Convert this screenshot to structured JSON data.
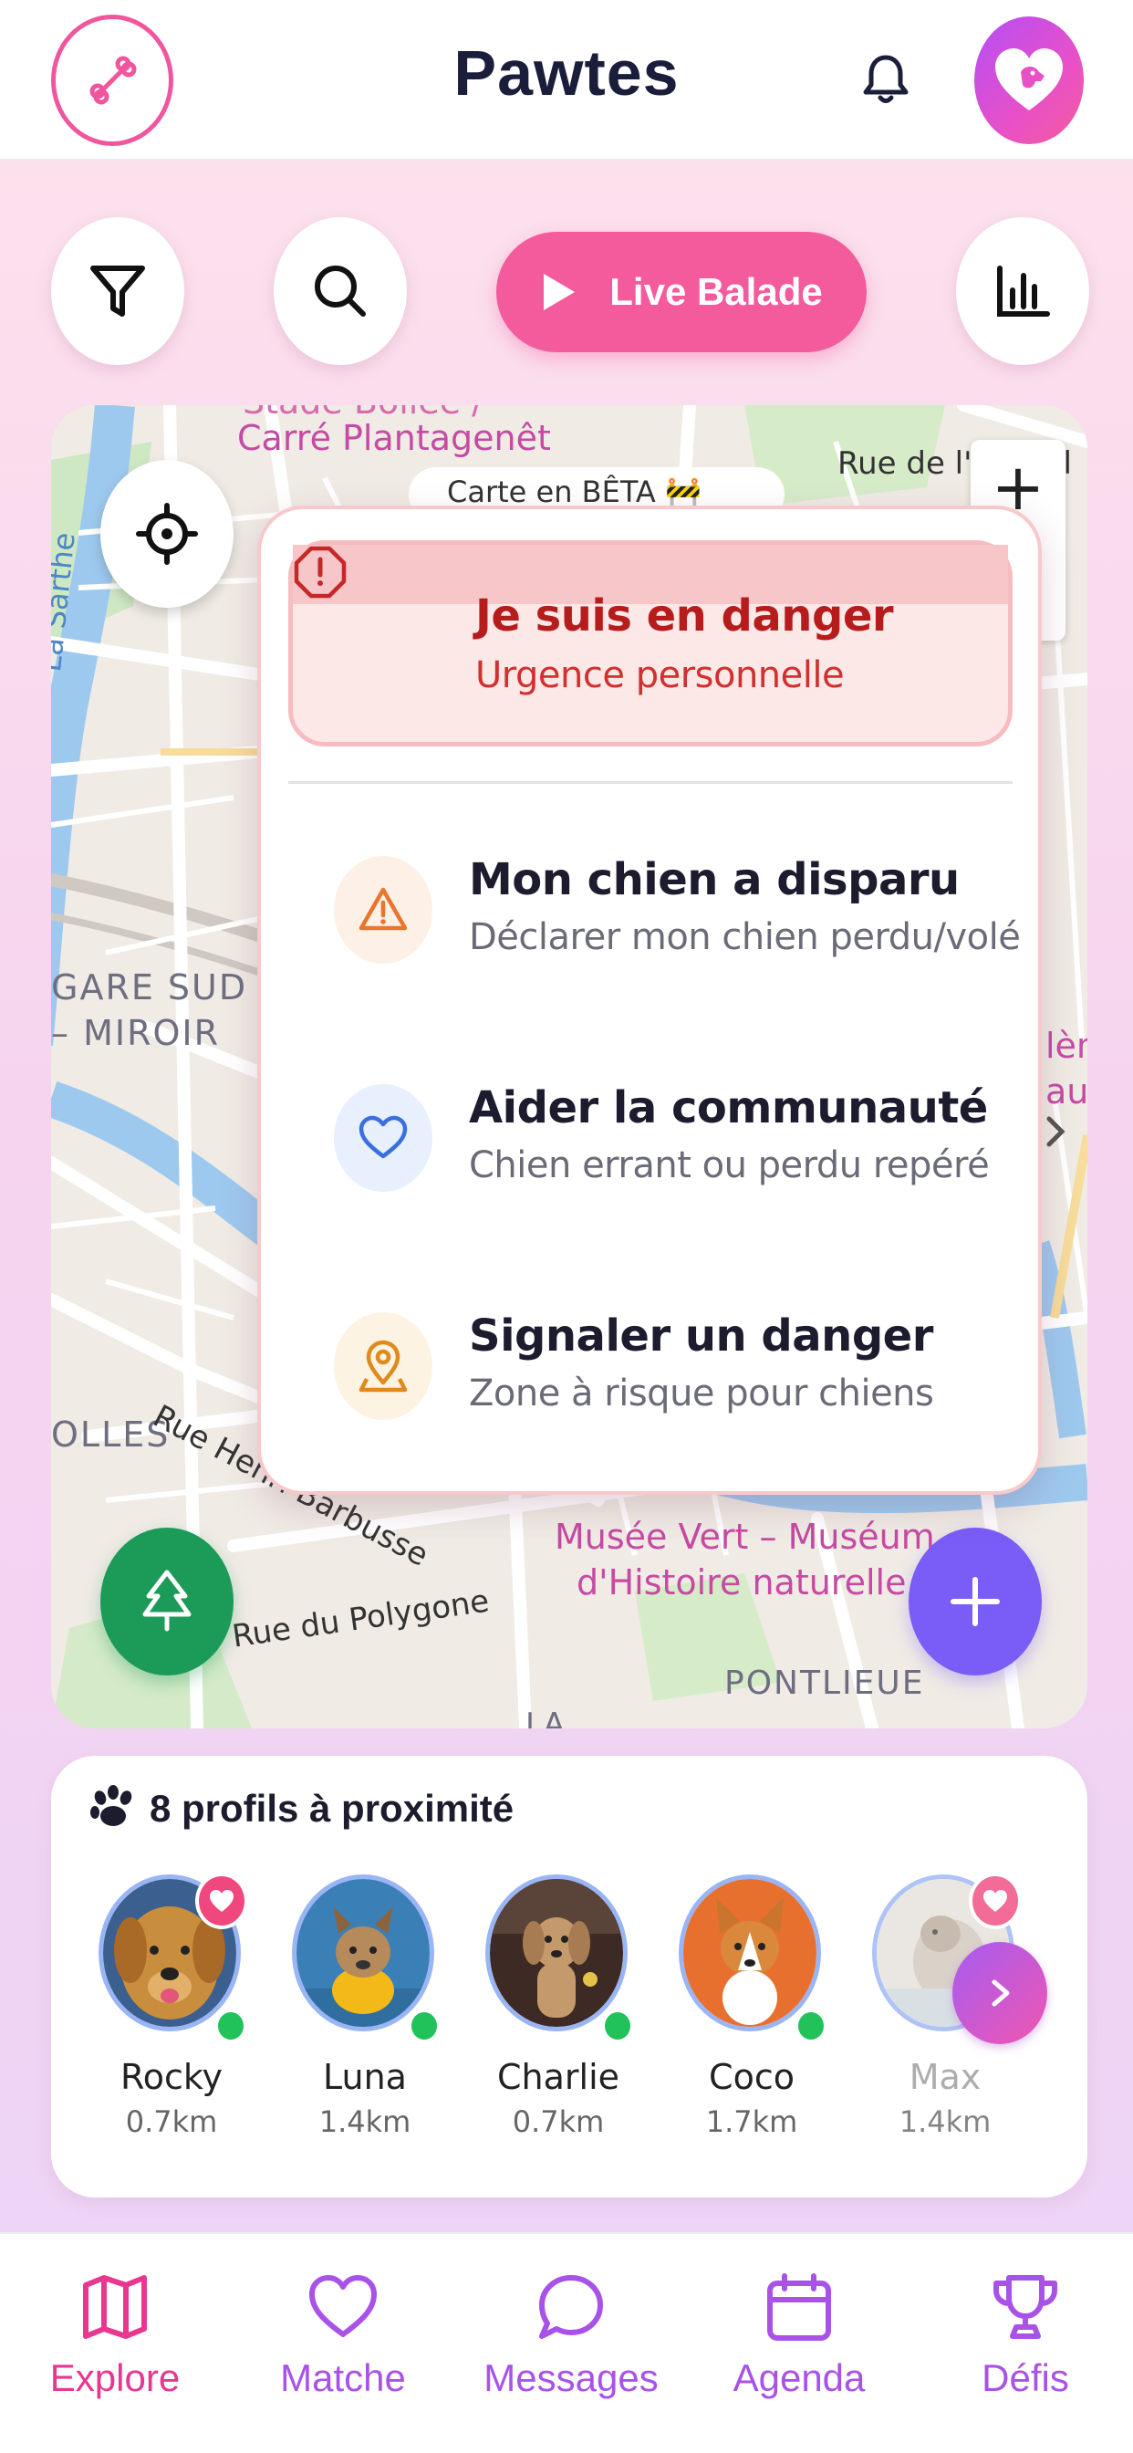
{
  "header": {
    "title": "Pawtes",
    "menu_icon": "bone-icon",
    "notification_icon": "bell-icon",
    "avatar_icon": "heart-dog-icon"
  },
  "toolbar": {
    "filter_icon": "filter-icon",
    "search_icon": "search-icon",
    "live_label": "Live Balade",
    "stats_icon": "bar-chart-icon"
  },
  "map": {
    "beta_text": "Carte en BÊTA 🚧",
    "labels": {
      "top_left": "Carré Plantagenêt",
      "top_left_faded": "Stade Bollée / ",
      "top_right_street": "Rue de l'E",
      "top_right_tail": "il",
      "river": "La Sarthe",
      "gare_sud": "GARE SUD",
      "miroir": "– MIROIR",
      "olles": "OLLES",
      "rue_henri": "Rue Henri Barbusse",
      "rue_polygone": "Rue du Polygone",
      "musee_line1": "Musée Vert – Muséum",
      "musee_line2": "d'Histoire naturelle",
      "pontlieue": "PONTLIEUE",
      "right_partial1": "lèn",
      "right_partial2": "au",
      "la_partial": "LA"
    },
    "zoom_in": "+",
    "locate_icon": "crosshair-icon",
    "tree_icon": "tree-icon",
    "add_icon": "plus-icon"
  },
  "emergency_menu": {
    "items": [
      {
        "title": "Je suis en danger",
        "subtitle": "Urgence personnelle",
        "icon": "alert-octagon-icon"
      },
      {
        "title": "Mon chien a disparu",
        "subtitle": "Déclarer mon chien perdu/volé",
        "icon": "warning-triangle-icon"
      },
      {
        "title": "Aider la communauté",
        "subtitle": "Chien errant ou perdu repéré",
        "icon": "heart-icon"
      },
      {
        "title": "Signaler un danger",
        "subtitle": "Zone à risque pour chiens",
        "icon": "map-pin-icon"
      }
    ]
  },
  "nearby": {
    "title": "8 profils à proximité",
    "paw_icon": "paw-icon",
    "profiles": [
      {
        "name": "Rocky",
        "distance": "0.7km"
      },
      {
        "name": "Luna",
        "distance": "1.4km"
      },
      {
        "name": "Charlie",
        "distance": "0.7km"
      },
      {
        "name": "Coco",
        "distance": "1.7km"
      },
      {
        "name": "Max",
        "distance": "1.4km"
      }
    ],
    "next_icon": "chevron-right-icon"
  },
  "bottom_nav": {
    "items": [
      {
        "label": "Explore",
        "icon": "map-icon"
      },
      {
        "label": "Matche",
        "icon": "heart-icon"
      },
      {
        "label": "Messages",
        "icon": "chat-bubble-icon"
      },
      {
        "label": "Agenda",
        "icon": "calendar-icon"
      },
      {
        "label": "Défis",
        "icon": "trophy-icon"
      }
    ]
  },
  "colors": {
    "brand_pink": "#f45b9c",
    "danger_red": "#c62828",
    "purple": "#7a5cf6",
    "green": "#1c9a57",
    "nav_inactive": "#a952e8"
  }
}
